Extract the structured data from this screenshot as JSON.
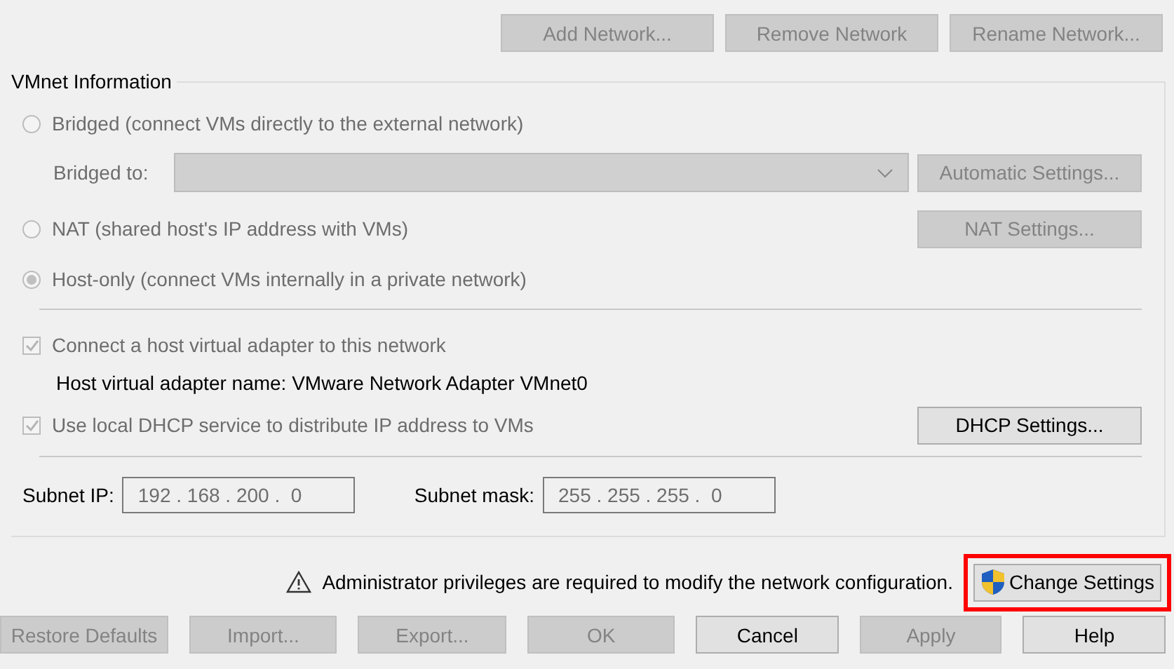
{
  "toolbar_buttons": [
    {
      "label": "Add Network...",
      "disabled": true
    },
    {
      "label": "Remove Network",
      "disabled": true
    },
    {
      "label": "Rename Network...",
      "disabled": true
    }
  ],
  "vmnet_information": {
    "title": "VMnet Information",
    "modes": [
      {
        "label": "Bridged (connect VMs directly to the external network)",
        "selected": false,
        "disabled": true
      },
      {
        "label": "NAT (shared host's IP address with VMs)",
        "selected": false,
        "disabled": true
      },
      {
        "label": "Host-only (connect VMs internally in a private network)",
        "selected": true,
        "disabled": true
      }
    ],
    "bridged_to": {
      "label": "Bridged to:",
      "disabled": true
    },
    "automatic_settings_button": {
      "label": "Automatic Settings...",
      "disabled": true
    },
    "nat_settings_button": {
      "label": "NAT Settings...",
      "disabled": true
    },
    "connect_adapter": {
      "label": "Connect a host virtual adapter to this network",
      "checked": true,
      "disabled": true
    },
    "adapter_name": "Host virtual adapter name: VMware Network Adapter VMnet0",
    "dhcp": {
      "label": "Use local DHCP service to distribute IP address to VMs",
      "checked": true,
      "disabled": true
    },
    "dhcp_settings_button": {
      "label": "DHCP Settings...",
      "disabled": false
    },
    "subnet_ip": {
      "label": "Subnet IP:",
      "value": "192 . 168 . 200 .  0"
    },
    "subnet_mask": {
      "label": "Subnet mask:",
      "value": "255 . 255 . 255 .  0"
    }
  },
  "admin_notice": {
    "text": "Administrator privileges are required to modify the network configuration.",
    "button": {
      "label": "Change Settings",
      "disabled": false,
      "highlighted": true
    }
  },
  "footer_buttons": [
    {
      "label": "Restore Defaults",
      "disabled": true
    },
    {
      "label": "Import...",
      "disabled": true
    },
    {
      "label": "Export...",
      "disabled": true
    },
    {
      "label": "OK",
      "disabled": true
    },
    {
      "label": "Cancel",
      "disabled": false
    },
    {
      "label": "Apply",
      "disabled": true
    },
    {
      "label": "Help",
      "disabled": false
    }
  ]
}
